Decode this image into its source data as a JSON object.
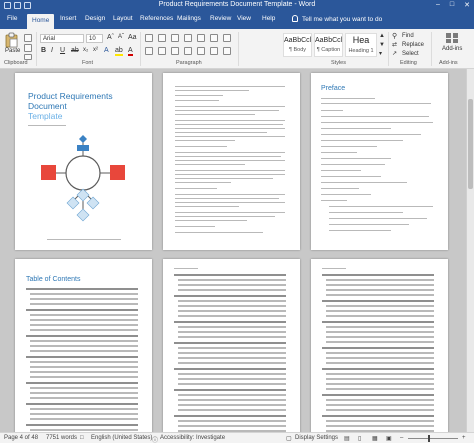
{
  "window": {
    "title": "Product Requirements Document Template - Word"
  },
  "tabs": [
    {
      "label": "File"
    },
    {
      "label": "Home"
    },
    {
      "label": "Insert"
    },
    {
      "label": "Design"
    },
    {
      "label": "Layout"
    },
    {
      "label": "References"
    },
    {
      "label": "Mailings"
    },
    {
      "label": "Review"
    },
    {
      "label": "View"
    },
    {
      "label": "Help"
    }
  ],
  "tell_me": "Tell me what you want to do",
  "ribbon": {
    "clipboard": {
      "paste_label": "Paste",
      "group_label": "Clipboard"
    },
    "font": {
      "font_name": "Arial",
      "font_size": "10",
      "group_label": "Font"
    },
    "paragraph": {
      "group_label": "Paragraph"
    },
    "styles": {
      "group_label": "Styles",
      "items": [
        {
          "sample": "AaBbCcl",
          "name": "¶ Body"
        },
        {
          "sample": "AaBbCcl",
          "name": "¶ Caption"
        },
        {
          "sample": "Hea",
          "name": "Heading 1"
        }
      ]
    },
    "editing": {
      "find": "Find",
      "replace": "Replace",
      "select": "Select",
      "group_label": "Editing"
    },
    "addins": {
      "label": "Add-ins",
      "group_label": "Add-ins"
    }
  },
  "pages": {
    "cover": {
      "title_line1": "Product Requirements",
      "title_line2": "Document",
      "title_line3": "Template"
    },
    "preface": {
      "heading": "Preface"
    },
    "toc": {
      "heading": "Table of Contents"
    }
  },
  "status": {
    "page": "Page 4 of 48",
    "words": "7751 words",
    "language": "English (United States)",
    "accessibility": "Accessibility: Investigate",
    "display": "Display Settings"
  },
  "colors": {
    "brand": "#2b579a",
    "heading_blue": "#2f78b5",
    "diagram_red": "#e8473b",
    "diagram_blue": "#3b82c4",
    "diagram_lightblue": "#cfe3f3"
  }
}
